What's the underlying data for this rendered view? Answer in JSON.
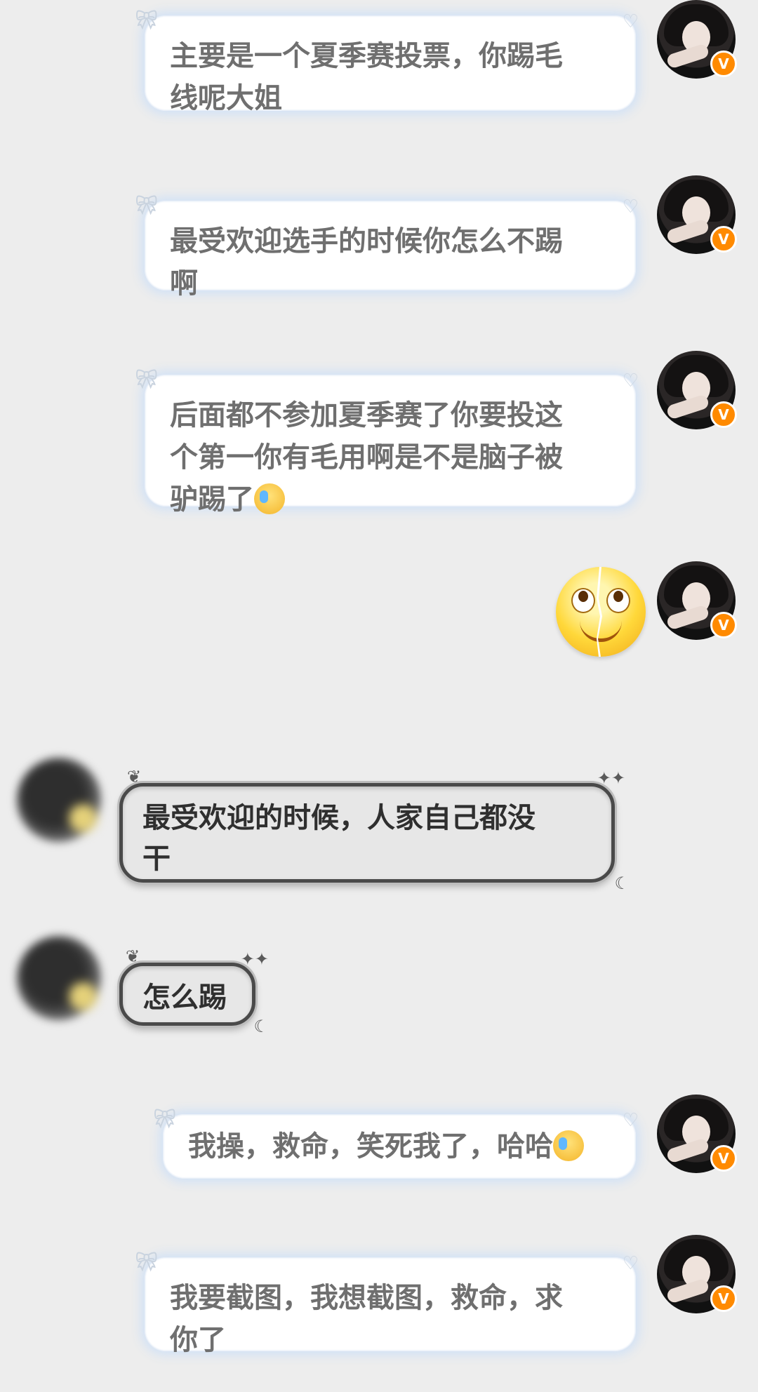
{
  "messages": [
    {
      "side": "right",
      "text": "主要是一个夏季赛投票，你踢毛线呢大姐",
      "lines": [
        "主要是一个夏季赛投票，你踢毛",
        "线呢大姐"
      ]
    },
    {
      "side": "right",
      "text": "最受欢迎选手的时候你怎么不踢啊",
      "lines": [
        "最受欢迎选手的时候你怎么不踢",
        "啊"
      ]
    },
    {
      "side": "right",
      "text": "后面都不参加夏季赛了你要投这个第一你有毛用啊是不是脑子被驴踢了",
      "lines": [
        "后面都不参加夏季赛了你要投这",
        "个第一你有毛用啊是不是脑子被",
        "驴踢了"
      ],
      "trailing_emoji": "laugh-cry-emoji"
    },
    {
      "side": "right",
      "type": "sticker",
      "sticker": "broken-smile-emoji"
    },
    {
      "side": "left",
      "text": "最受欢迎的时候，人家自己都没干",
      "lines": [
        "最受欢迎的时候，人家自己都没",
        "干"
      ]
    },
    {
      "side": "left",
      "text": "怎么踢",
      "lines": [
        "怎么踢"
      ]
    },
    {
      "side": "right",
      "text": "我操，救命，笑死我了，哈哈",
      "lines": [
        "我操，救命，笑死我了，哈哈"
      ],
      "trailing_emoji": "sweat-smile-emoji"
    },
    {
      "side": "right",
      "text": "我要截图，我想截图，救命，求你了",
      "lines": [
        "我要截图，我想截图，救命，求",
        "你了"
      ]
    }
  ],
  "badge_label": "V",
  "colors": {
    "background": "#ededed",
    "badge": "#ff8a00",
    "right_bubble": "#ffffff",
    "left_bubble": "#e7e7e7"
  }
}
